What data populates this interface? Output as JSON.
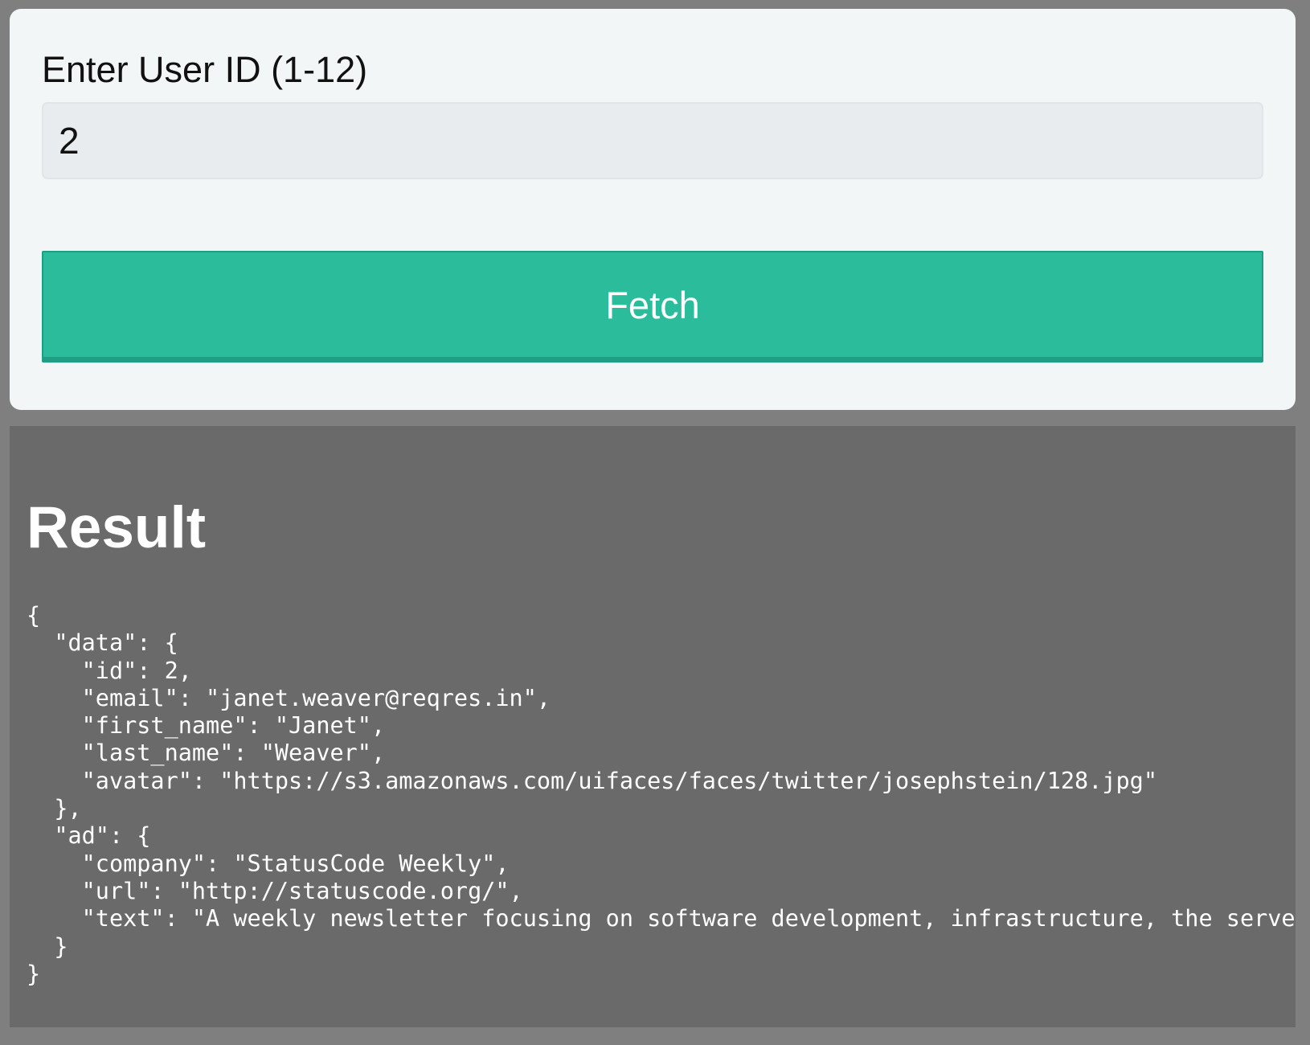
{
  "form": {
    "label": "Enter User ID (1-12)",
    "input_value": "2",
    "fetch_label": "Fetch"
  },
  "result": {
    "heading": "Result",
    "json_text": "{\n  \"data\": {\n    \"id\": 2,\n    \"email\": \"janet.weaver@reqres.in\",\n    \"first_name\": \"Janet\",\n    \"last_name\": \"Weaver\",\n    \"avatar\": \"https://s3.amazonaws.com/uifaces/faces/twitter/josephstein/128.jpg\"\n  },\n  \"ad\": {\n    \"company\": \"StatusCode Weekly\",\n    \"url\": \"http://statuscode.org/\",\n    \"text\": \"A weekly newsletter focusing on software development, infrastructure, the serve\n  }\n}"
  },
  "colors": {
    "page_background": "#7f7f7f",
    "card_background": "#f2f6f7",
    "button_accent": "#2bbc9c",
    "result_background": "#6a6a6a"
  }
}
